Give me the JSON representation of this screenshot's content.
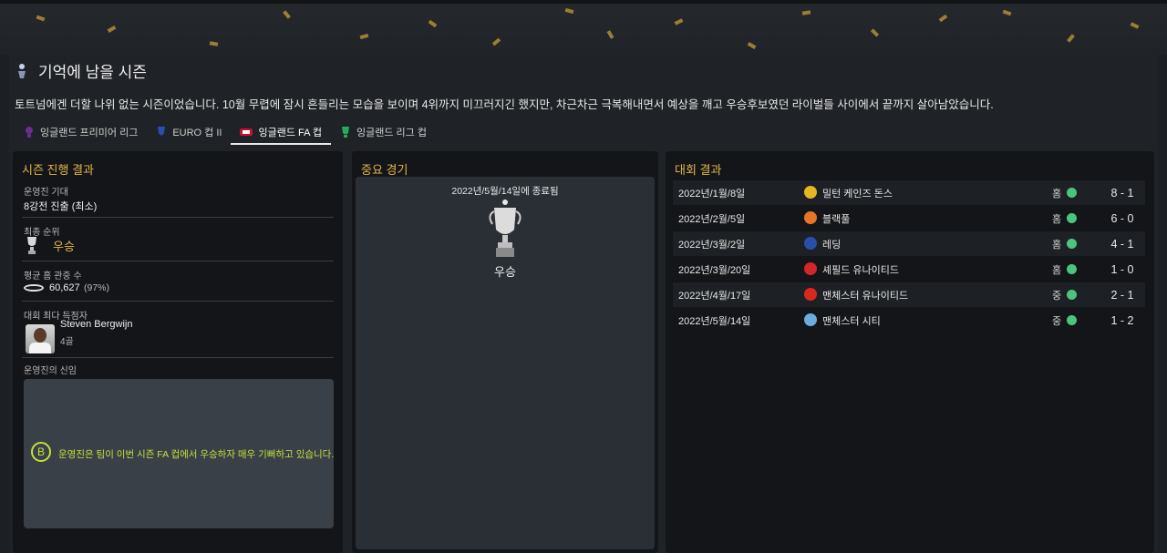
{
  "header": {
    "title": "기억에 남을 시즌"
  },
  "summary": "토트넘에겐 더할 나위 없는 시즌이었습니다. 10월 무렵에 잠시 흔들리는 모습을 보이며 4위까지 미끄러지긴 했지만, 차근차근 극복해내면서 예상을 깨고 우승후보였던 라이벌들 사이에서 끝까지 살아남았습니다.",
  "tabs": [
    {
      "label": "잉글랜드 프리미어 리그",
      "icon": "premier-league-icon",
      "active": false
    },
    {
      "label": "EURO 컵 II",
      "icon": "euro-cup-icon",
      "active": false
    },
    {
      "label": "잉글랜드 FA 컵",
      "icon": "fa-cup-icon",
      "active": true
    },
    {
      "label": "잉글랜드 리그 컵",
      "icon": "league-cup-icon",
      "active": false
    }
  ],
  "season_panel": {
    "title": "시즌 진행 결과",
    "expectation_label": "운영진 기대",
    "expectation_value": "8강전 진출 (최소)",
    "final_rank_label": "최종 순위",
    "final_rank_value": "우승",
    "attendance_label": "평균 홈 관중 수",
    "attendance_value": "60,627",
    "attendance_pct": "(97%)",
    "top_scorer_label": "대회 최다 득점자",
    "top_scorer_name": "Steven Bergwijn",
    "top_scorer_goals": "4골",
    "board_label": "운영진의 신임",
    "board_grade": "B",
    "board_text": "운영진은 팀이 이번 시즌 FA 컵에서 우승하자 매우 기뻐하고 있습니다."
  },
  "match_panel": {
    "title": "중요 경기",
    "date": "2022년/5월/14일에 종료됨",
    "result": "우승"
  },
  "results_panel": {
    "title": "대회 결과",
    "rows": [
      {
        "date": "2022년/1월/8일",
        "team": "밀턴 케인즈 돈스",
        "venue": "홈",
        "score": "8 - 1",
        "crest_color": "#e6b820"
      },
      {
        "date": "2022년/2월/5일",
        "team": "블랙풀",
        "venue": "홈",
        "score": "6 - 0",
        "crest_color": "#e8742a"
      },
      {
        "date": "2022년/3월/2일",
        "team": "레딩",
        "venue": "홈",
        "score": "4 - 1",
        "crest_color": "#2a4fa8"
      },
      {
        "date": "2022년/3월/20일",
        "team": "셰필드 유나이티드",
        "venue": "홈",
        "score": "1 - 0",
        "crest_color": "#d2262e"
      },
      {
        "date": "2022년/4월/17일",
        "team": "맨체스터 유나이티드",
        "venue": "중",
        "score": "2 - 1",
        "crest_color": "#da291c"
      },
      {
        "date": "2022년/5월/14일",
        "team": "맨체스터 시티",
        "venue": "중",
        "score": "1 - 2",
        "crest_color": "#6cabdd"
      }
    ]
  },
  "colors": {
    "accent_gold": "#e3b54a",
    "win_green": "#4cc47f",
    "board_lime": "#c4e03a"
  }
}
